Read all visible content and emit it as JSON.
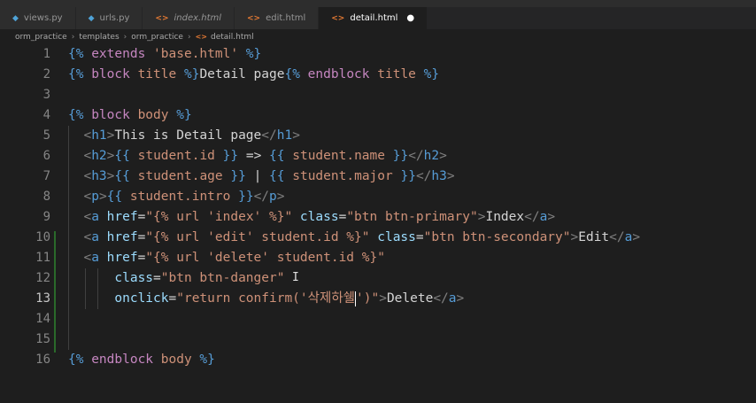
{
  "tabs": [
    {
      "label": "views.py",
      "type": "py",
      "icon": "python-file-icon",
      "active": false,
      "italic": false
    },
    {
      "label": "urls.py",
      "type": "py",
      "icon": "python-file-icon",
      "active": false,
      "italic": false
    },
    {
      "label": "index.html",
      "type": "html",
      "icon": "html-file-icon",
      "active": false,
      "italic": true
    },
    {
      "label": "edit.html",
      "type": "html",
      "icon": "html-file-icon",
      "active": false,
      "italic": false
    },
    {
      "label": "detail.html",
      "type": "html",
      "icon": "html-file-icon",
      "active": true,
      "italic": false,
      "modified": true
    }
  ],
  "breadcrumb": [
    "orm_practice",
    "templates",
    "orm_practice",
    "detail.html"
  ],
  "lines": [
    {
      "n": "1",
      "tokens": [
        [
          "dj",
          "{%"
        ],
        [
          "kw",
          " extends "
        ],
        [
          "st",
          "'base.html'"
        ],
        [
          "dj",
          " %}"
        ]
      ]
    },
    {
      "n": "2",
      "tokens": [
        [
          "dj",
          "{%"
        ],
        [
          "kw",
          " block "
        ],
        [
          "st",
          "title"
        ],
        [
          "dj",
          " %}"
        ],
        [
          "tx",
          "Detail page"
        ],
        [
          "dj",
          "{%"
        ],
        [
          "kw",
          " endblock "
        ],
        [
          "st",
          "title"
        ],
        [
          "dj",
          " %}"
        ]
      ]
    },
    {
      "n": "3",
      "tokens": []
    },
    {
      "n": "4",
      "tokens": [
        [
          "dj",
          "{%"
        ],
        [
          "kw",
          " block "
        ],
        [
          "st",
          "body"
        ],
        [
          "dj",
          " %}"
        ]
      ]
    },
    {
      "n": "5",
      "tokens": [
        [
          "tx",
          "  "
        ],
        [
          "tg",
          "<"
        ],
        [
          "tn",
          "h1"
        ],
        [
          "tg",
          ">"
        ],
        [
          "tx",
          "This is Detail page"
        ],
        [
          "tg",
          "</"
        ],
        [
          "tn",
          "h1"
        ],
        [
          "tg",
          ">"
        ]
      ]
    },
    {
      "n": "6",
      "tokens": [
        [
          "tx",
          "  "
        ],
        [
          "tg",
          "<"
        ],
        [
          "tn",
          "h2"
        ],
        [
          "tg",
          ">"
        ],
        [
          "dj",
          "{{"
        ],
        [
          "st",
          " student.id "
        ],
        [
          "dj",
          "}}"
        ],
        [
          "tx",
          " => "
        ],
        [
          "dj",
          "{{"
        ],
        [
          "st",
          " student.name "
        ],
        [
          "dj",
          "}}"
        ],
        [
          "tg",
          "</"
        ],
        [
          "tn",
          "h2"
        ],
        [
          "tg",
          ">"
        ]
      ]
    },
    {
      "n": "7",
      "tokens": [
        [
          "tx",
          "  "
        ],
        [
          "tg",
          "<"
        ],
        [
          "tn",
          "h3"
        ],
        [
          "tg",
          ">"
        ],
        [
          "dj",
          "{{"
        ],
        [
          "st",
          " student.age "
        ],
        [
          "dj",
          "}}"
        ],
        [
          "tx",
          " | "
        ],
        [
          "dj",
          "{{"
        ],
        [
          "st",
          " student.major "
        ],
        [
          "dj",
          "}}"
        ],
        [
          "tg",
          "</"
        ],
        [
          "tn",
          "h3"
        ],
        [
          "tg",
          ">"
        ]
      ]
    },
    {
      "n": "8",
      "tokens": [
        [
          "tx",
          "  "
        ],
        [
          "tg",
          "<"
        ],
        [
          "tn",
          "p"
        ],
        [
          "tg",
          ">"
        ],
        [
          "dj",
          "{{"
        ],
        [
          "st",
          " student.intro "
        ],
        [
          "dj",
          "}}"
        ],
        [
          "tg",
          "</"
        ],
        [
          "tn",
          "p"
        ],
        [
          "tg",
          ">"
        ]
      ]
    },
    {
      "n": "9",
      "tokens": [
        [
          "tx",
          "  "
        ],
        [
          "tg",
          "<"
        ],
        [
          "tn",
          "a"
        ],
        [
          "at",
          " href"
        ],
        [
          "tx",
          "="
        ],
        [
          "st",
          "\"{% url 'index' %}\""
        ],
        [
          "at",
          " class"
        ],
        [
          "tx",
          "="
        ],
        [
          "st",
          "\"btn btn-primary\""
        ],
        [
          "tg",
          ">"
        ],
        [
          "tx",
          "Index"
        ],
        [
          "tg",
          "</"
        ],
        [
          "tn",
          "a"
        ],
        [
          "tg",
          ">"
        ]
      ]
    },
    {
      "n": "10",
      "tokens": [
        [
          "tx",
          "  "
        ],
        [
          "tg",
          "<"
        ],
        [
          "tn",
          "a"
        ],
        [
          "at",
          " href"
        ],
        [
          "tx",
          "="
        ],
        [
          "st",
          "\"{% url 'edit' student.id %}\""
        ],
        [
          "at",
          " class"
        ],
        [
          "tx",
          "="
        ],
        [
          "st",
          "\"btn btn-secondary\""
        ],
        [
          "tg",
          ">"
        ],
        [
          "tx",
          "Edit"
        ],
        [
          "tg",
          "</"
        ],
        [
          "tn",
          "a"
        ],
        [
          "tg",
          ">"
        ]
      ]
    },
    {
      "n": "11",
      "tokens": [
        [
          "tx",
          "  "
        ],
        [
          "tg",
          "<"
        ],
        [
          "tn",
          "a"
        ],
        [
          "at",
          " href"
        ],
        [
          "tx",
          "="
        ],
        [
          "st",
          "\"{% url 'delete' student.id %}\""
        ]
      ]
    },
    {
      "n": "12",
      "tokens": [
        [
          "tx",
          "      "
        ],
        [
          "at",
          "class"
        ],
        [
          "tx",
          "="
        ],
        [
          "st",
          "\"btn btn-danger\""
        ]
      ]
    },
    {
      "n": "13",
      "tokens": [
        [
          "tx",
          "      "
        ],
        [
          "at",
          "onclick"
        ],
        [
          "tx",
          "="
        ],
        [
          "st",
          "\"return confirm('삭제하쉘"
        ],
        [
          "cursor",
          ""
        ],
        [
          "st",
          "')\""
        ],
        [
          "tg",
          ">"
        ],
        [
          "tx",
          "Delete"
        ],
        [
          "tg",
          "</"
        ],
        [
          "tn",
          "a"
        ],
        [
          "tg",
          ">"
        ]
      ]
    },
    {
      "n": "14",
      "tokens": []
    },
    {
      "n": "15",
      "tokens": []
    },
    {
      "n": "16",
      "tokens": [
        [
          "dj",
          "{%"
        ],
        [
          "kw",
          " endblock "
        ],
        [
          "st",
          "body"
        ],
        [
          "dj",
          " %}"
        ]
      ]
    }
  ],
  "current_line": "13",
  "colors": {
    "background": "#1e1e1e",
    "tag": "#569cd6",
    "attribute": "#9cdcfe",
    "string": "#ce9178",
    "keyword": "#c586c0"
  }
}
